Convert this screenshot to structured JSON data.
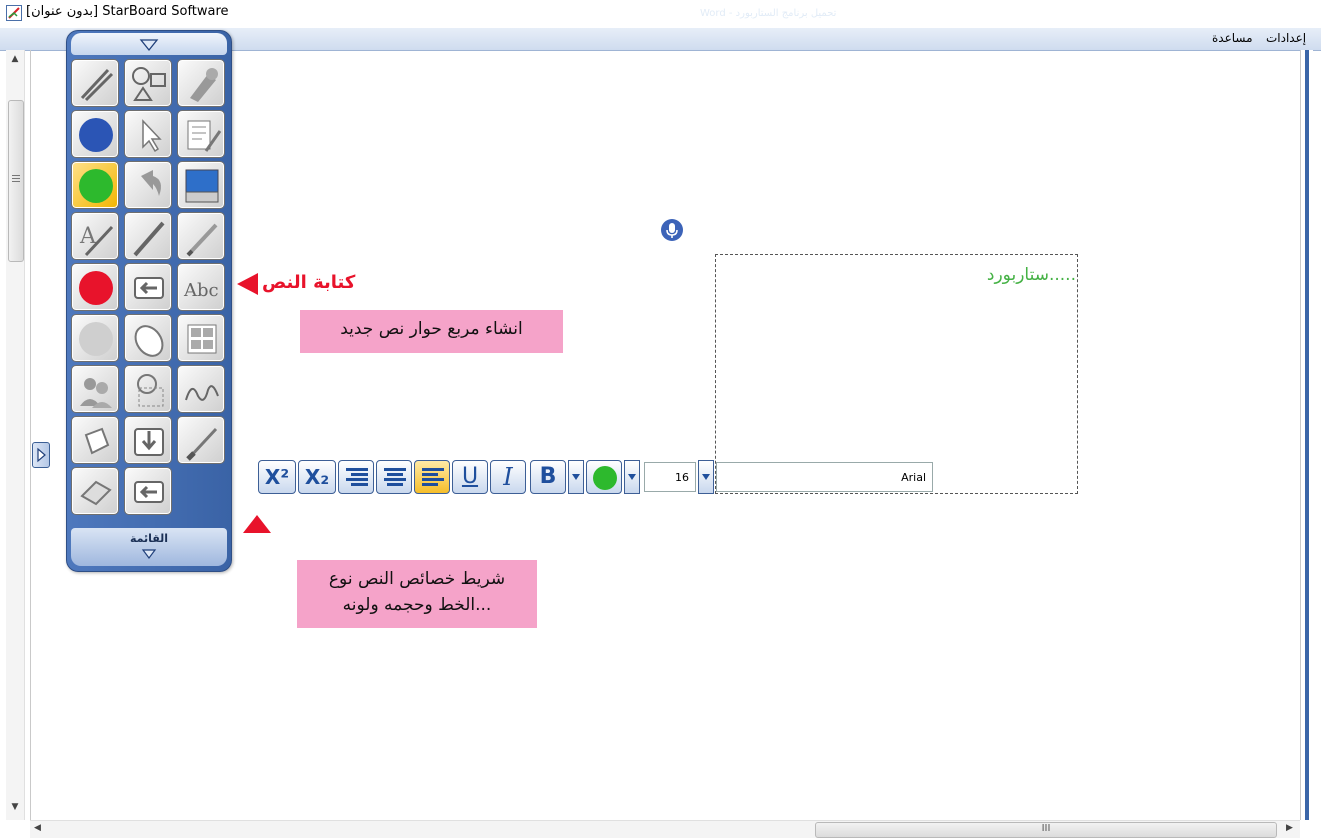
{
  "window": {
    "title": "[بدون عنوان] StarBoard Software",
    "faded_title_text": "Word - تحميل برنامج الستاربورد"
  },
  "menu": {
    "settings": "إعدادات",
    "help": "مساعدة"
  },
  "toolbox": {
    "menu_label": "القائمة",
    "tools": [
      "pen-tool-icon",
      "shapes-icon",
      "tools-icon",
      "blue-color-icon",
      "pointer-icon",
      "edit-icon",
      "green-color-icon",
      "undo-icon",
      "keyboard-icon",
      "text-pen-icon",
      "pencil-icon",
      "marker-icon",
      "red-color-icon",
      "back-page-icon",
      "text-tool-icon",
      "gray-color-icon",
      "mouse-icon",
      "layout-icon",
      "users-icon",
      "zoom-icon",
      "signature-icon",
      "bucket-icon",
      "import-icon",
      "brush-icon",
      "eraser-icon",
      "prev-page-icon"
    ],
    "text_tool_label": "Abc"
  },
  "canvas": {
    "text_box_content": "ستاربورد....."
  },
  "annotations": {
    "write_text": "كتابة النص",
    "create_box": "انشاء مربع حوار نص جديد",
    "toolbar_desc_line1": "شريط خصائص النص نوع",
    "toolbar_desc_line2": "الخط وحجمه ولونه..."
  },
  "format_toolbar": {
    "superscript": "X²",
    "subscript": "X₂",
    "underline": "U",
    "italic": "I",
    "bold": "B",
    "font_size": "16",
    "font_name": "Arial",
    "text_color": "#2db92d"
  },
  "scroll": {
    "h_thumb_label": "III"
  }
}
